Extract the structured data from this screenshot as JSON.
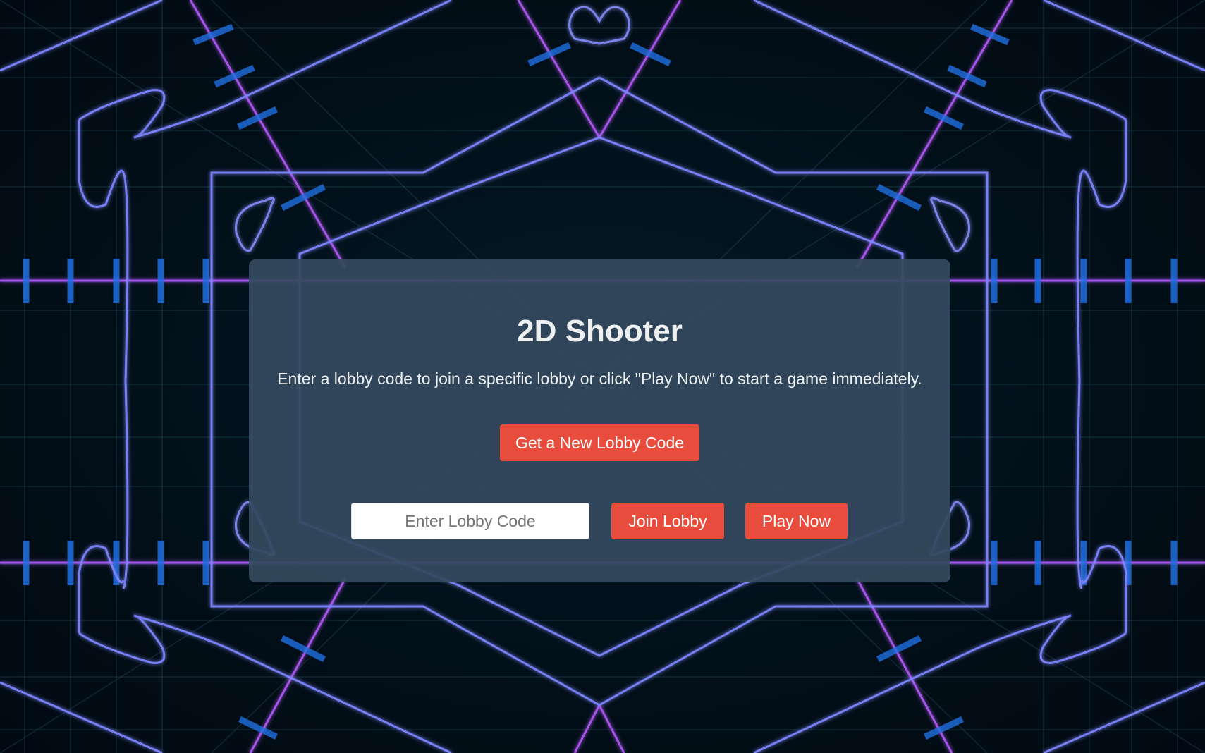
{
  "app": {
    "title": "2D Shooter",
    "subtitle": "Enter a lobby code to join a specific lobby or click \"Play Now\" to start a game immediately."
  },
  "actions": {
    "new_lobby_label": "Get a New Lobby Code",
    "lobby_input_placeholder": "Enter Lobby Code",
    "lobby_input_value": "",
    "join_label": "Join Lobby",
    "play_label": "Play Now"
  },
  "colors": {
    "background": "#020f18",
    "panel": "#34495e",
    "button": "#e74c3c",
    "text": "#ecf0f1",
    "neon_blue": "#7f86ff",
    "neon_magenta": "#c15cff"
  }
}
